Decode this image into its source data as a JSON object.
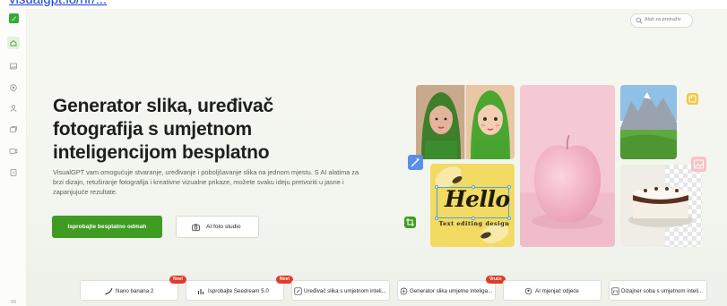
{
  "colors": {
    "brand_green": "#3f9b22",
    "badge_red": "#e5392a",
    "selection_blue": "#49a6d8"
  },
  "browser": {
    "url_fragment": "visualgpt.io/hr/..."
  },
  "sidebar": {
    "items": [
      {
        "icon": "home-icon"
      },
      {
        "icon": "image-icon"
      },
      {
        "icon": "circle-icon"
      },
      {
        "icon": "people-icon"
      },
      {
        "icon": "cards-icon"
      },
      {
        "icon": "video-icon"
      },
      {
        "icon": "file-icon"
      }
    ],
    "bottom_icon": "expand-icon"
  },
  "search": {
    "placeholder": "Alati za pretraživ",
    "icon": "search-icon"
  },
  "hero": {
    "headline": "Generator slika, uređivač fotografija s umjetnom inteligencijom besplatno",
    "description": "VisualGPT vam omogućuje stvaranje, uređivanje i poboljšavanje slika na jednom mjestu. S AI alatima za brzi dizajn, retuširanje fotografija i kreativne vizualne prikaze, možete svaku ideju pretvoriti u jasne i zapanjujuće rezultate.",
    "primary_button": "Isprobajte besplatno odmah",
    "secondary_button": "AI foto studio",
    "secondary_icon": "camera-icon"
  },
  "gallery": {
    "hello_text": "Hello",
    "hello_subtitle": "Text editing design",
    "icons": [
      "magic-wand-icon",
      "crop-icon",
      "image-frame-icon",
      "image-add-icon"
    ]
  },
  "chips": [
    {
      "label": "Nano banana 2",
      "icon": "banana-icon",
      "badge": "Novi"
    },
    {
      "label": "Isprobajte Seedream 5.0",
      "icon": "chart-icon",
      "badge": "Novi"
    },
    {
      "label": "Uređivač slika s umjetnom inteli...",
      "icon": "edit-image-icon",
      "badge": ""
    },
    {
      "label": "Generator slika umjetne inteliga...",
      "icon": "image-gen-icon",
      "badge": "Vruće"
    },
    {
      "label": "AI mjenjač odjeće",
      "icon": "shirt-icon",
      "badge": ""
    },
    {
      "label": "Dizajner soba s umjetnom inteli...",
      "icon": "room-icon",
      "badge": ""
    }
  ]
}
